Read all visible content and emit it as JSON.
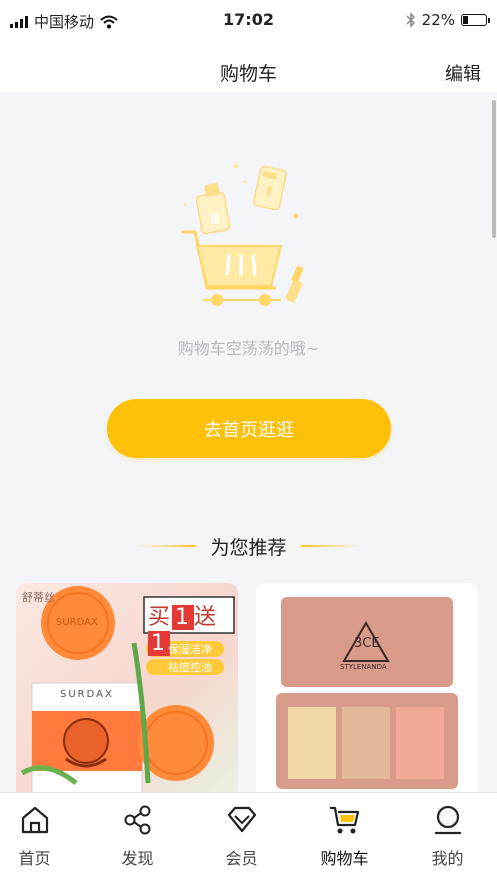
{
  "status_bar": {
    "carrier": "中国移动",
    "time": "17:02",
    "battery": "22%",
    "battery_level": 0.22
  },
  "nav": {
    "title": "购物车",
    "edit_label": "编辑"
  },
  "empty_state": {
    "message": "购物车空荡荡的哦~",
    "button_label": "去首页逛逛"
  },
  "recommend": {
    "title": "为您推荐",
    "products": [
      {
        "brand": "舒蒂丝",
        "ribbon_buy": "买",
        "ribbon_n1": "1",
        "ribbon_send": "送",
        "ribbon_n2": "1",
        "tag1": "保湿洁净",
        "tag2": "祛痘控油",
        "box_brand": "SURDAX",
        "soap_text": "SURDAX"
      },
      {
        "logo": "3CE",
        "logo_sub": "STYLENANDA"
      }
    ]
  },
  "colors": {
    "accent": "#ffc107",
    "background": "#f3f5f8"
  },
  "tab_bar": {
    "active_index": 3,
    "items": [
      {
        "label": "首页",
        "icon": "home-icon"
      },
      {
        "label": "发现",
        "icon": "share-nodes-icon"
      },
      {
        "label": "会员",
        "icon": "diamond-icon"
      },
      {
        "label": "购物车",
        "icon": "cart-icon"
      },
      {
        "label": "我的",
        "icon": "profile-icon"
      }
    ]
  }
}
